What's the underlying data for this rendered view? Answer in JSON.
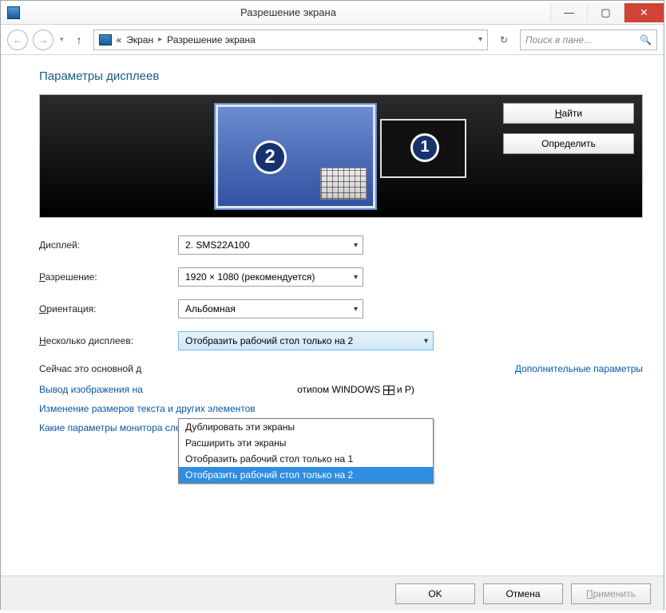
{
  "titlebar": {
    "title": "Разрешение экрана"
  },
  "address": {
    "chevrons": "«",
    "item1": "Экран",
    "item2": "Разрешение экрана"
  },
  "search": {
    "placeholder": "Поиск в пане..."
  },
  "heading": "Параметры дисплеев",
  "preview": {
    "find": "Найти",
    "identify": "Определить",
    "mon2": "2",
    "mon1": "1"
  },
  "form": {
    "display_label": "Дисплей:",
    "display_value": "2. SMS22A100",
    "resolution_label": "Разрешение:",
    "resolution_value": "1920 × 1080 (рекомендуется)",
    "orientation_label": "Ориентация:",
    "orientation_value": "Альбомная",
    "multi_label": "Несколько дисплеев:",
    "multi_value": "Отобразить рабочий стол только на 2"
  },
  "main_display_text": "Сейчас это основной д",
  "advanced_link": "Дополнительные параметры",
  "links": {
    "projector_pre": "Вывод изображения на",
    "projector_post": "отипом WINDOWS",
    "projector_key": "и P)",
    "text_size": "Изменение размеров текста и других элементов",
    "which_monitor": "Какие параметры монитора следует выбрать?"
  },
  "dropdown": {
    "opt1": "Дублировать эти экраны",
    "opt2": "Расширить эти экраны",
    "opt3": "Отобразить рабочий стол только на 1",
    "opt4": "Отобразить рабочий стол только на 2"
  },
  "footer": {
    "ok": "OK",
    "cancel": "Отмена",
    "apply": "Применить"
  }
}
